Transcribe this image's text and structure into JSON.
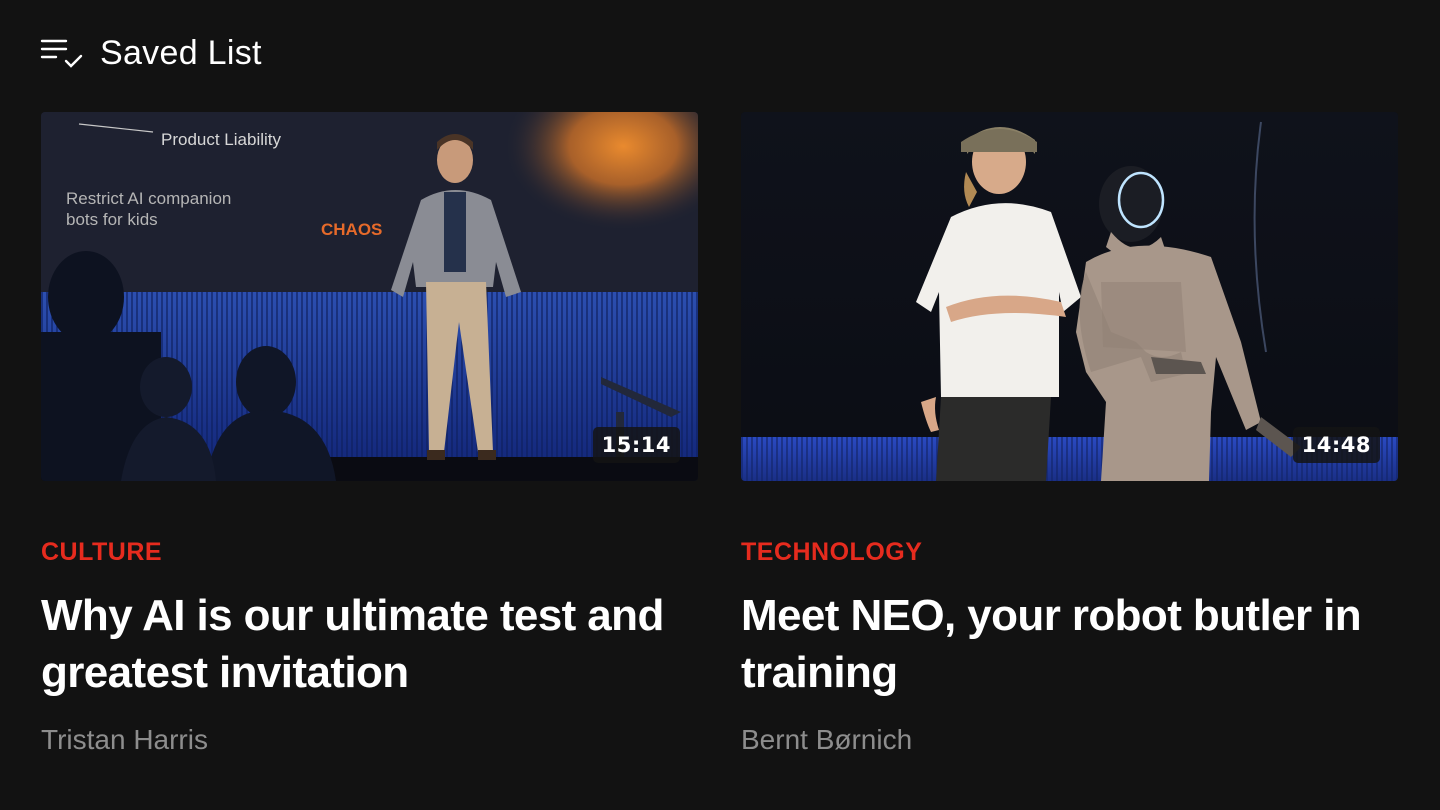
{
  "header": {
    "title": "Saved List",
    "icon": "playlist-check-icon"
  },
  "talks": [
    {
      "category": "CULTURE",
      "title": "Why AI is our ultimate test and greatest invitation",
      "speaker": "Tristan Harris",
      "duration": "15:14",
      "slide_text": {
        "line1": "Product Liability",
        "line2a": "Restrict AI companion",
        "line2b": "bots for kids",
        "word": "CHAOS"
      }
    },
    {
      "category": "TECHNOLOGY",
      "title": "Meet NEO, your robot butler in training",
      "speaker": "Bernt Børnich",
      "duration": "14:48"
    }
  ],
  "colors": {
    "background": "#121212",
    "accent": "#e62b1e",
    "secondary_text": "#8d8d8d"
  }
}
